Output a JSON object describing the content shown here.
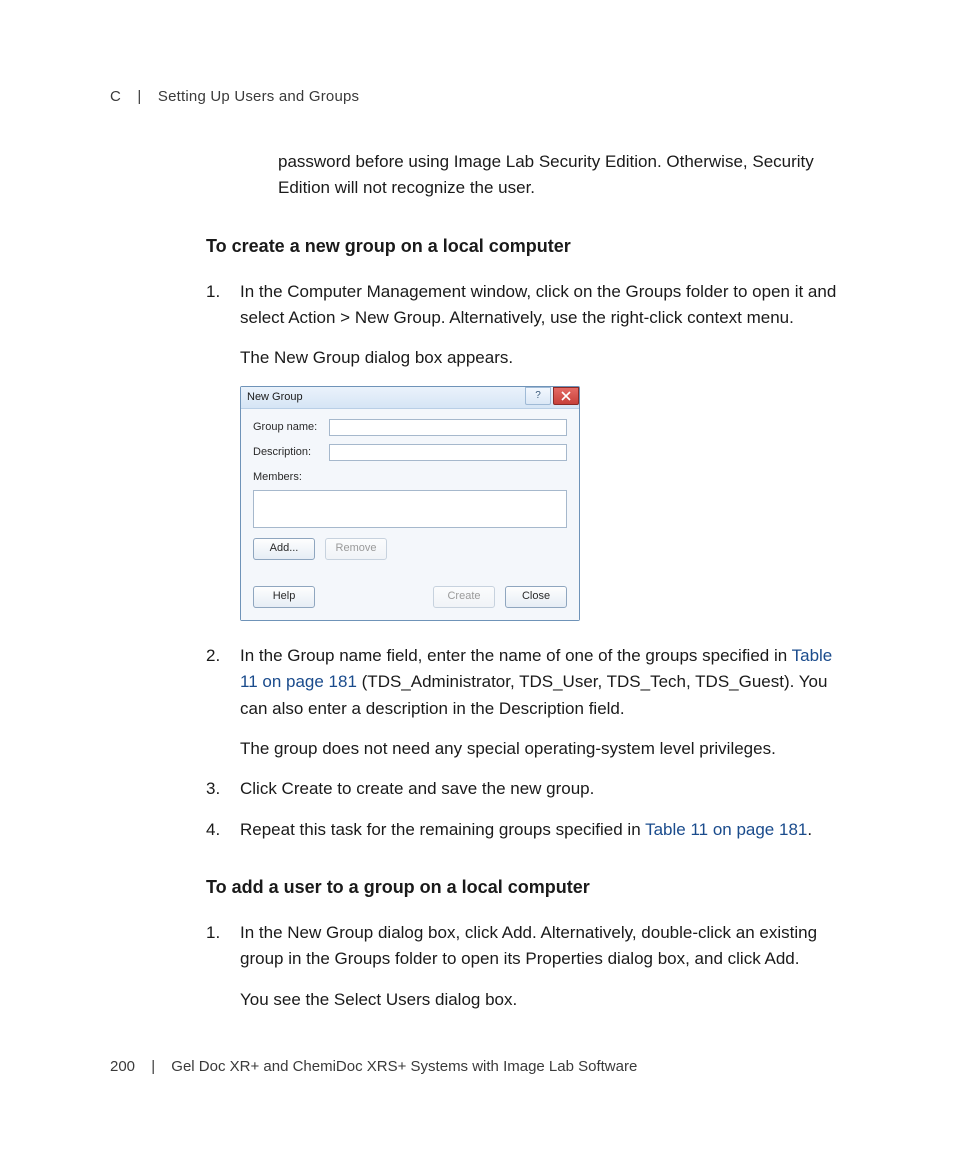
{
  "header": {
    "appendix": "C",
    "title": "Setting Up Users and Groups"
  },
  "intro_para": "password before using Image Lab Security Edition. Otherwise, Security Edition will not recognize the user.",
  "section1": {
    "heading": "To create a new group on a local computer",
    "step1_p1": "In the Computer Management window, click on the Groups folder to open it and select Action > New Group. Alternatively, use the right-click context menu.",
    "step1_p2": "The New Group dialog box appears.",
    "step2_prefix": "In the Group name field, enter the name of one of the groups specified in ",
    "step2_link": "Table 11 on page 181",
    "step2_suffix": " (TDS_Administrator, TDS_User, TDS_Tech, TDS_Guest). You can also enter a description in the Description field.",
    "step2_p2": "The group does not need any special operating-system level privileges.",
    "step3": "Click Create to create and save the new group.",
    "step4_prefix": "Repeat this task for the remaining groups specified in ",
    "step4_link": "Table 11 on page 181",
    "step4_suffix": "."
  },
  "section2": {
    "heading": "To add a user to a group on a local computer",
    "step1_p1": "In the New Group dialog box, click Add. Alternatively, double-click an existing group in the Groups folder to open its Properties dialog box, and click Add.",
    "step1_p2": "You see the Select Users dialog box."
  },
  "dialog": {
    "title": "New Group",
    "group_name_label": "Group name:",
    "group_name_value": "",
    "description_label": "Description:",
    "description_value": "",
    "members_label": "Members:",
    "buttons": {
      "add": "Add...",
      "remove": "Remove",
      "help": "Help",
      "create": "Create",
      "close": "Close"
    }
  },
  "footer": {
    "page": "200",
    "text": "Gel Doc XR+ and ChemiDoc XRS+ Systems with Image Lab Software"
  }
}
